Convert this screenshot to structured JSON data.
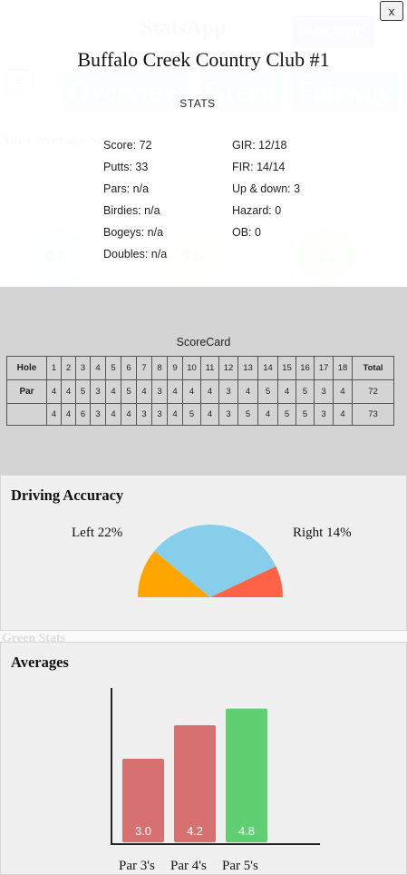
{
  "background": {
    "app_title": "StatsApp",
    "round_button_label": "ROUND",
    "menu_icon": "hamburger-icon",
    "tabs": [
      "Overview",
      "Green",
      "Fairway"
    ],
    "average_score_label": "Your Average Score",
    "circles": [
      {
        "value": "0.5",
        "color": "#9fb4e8"
      },
      {
        "value": "72",
        "color": "#e8e28a"
      },
      {
        "value": "1.2",
        "color": "#9fe0a8"
      }
    ],
    "green_stats_label": "Green Stats"
  },
  "modal": {
    "course_name": "Buffalo Creek Country Club #1",
    "close_label": "x",
    "stats_heading": "STATS",
    "stats_left": [
      "Score: 72",
      "Putts: 33",
      "Pars: n/a",
      "Birdies: n/a",
      "Bogeys: n/a",
      "Doubles: n/a"
    ],
    "stats_right": [
      "GIR: 12/18",
      "FIR: 14/14",
      "Up & down: 3",
      "Hazard: 0",
      "OB: 0"
    ]
  },
  "scorecard": {
    "title": "ScoreCard",
    "header_label": "Hole",
    "holes": [
      "1",
      "2",
      "3",
      "4",
      "5",
      "6",
      "7",
      "8",
      "9",
      "10",
      "11",
      "12",
      "13",
      "14",
      "15",
      "16",
      "17",
      "18"
    ],
    "total_label": "Total",
    "par_label": "Par",
    "par": [
      "4",
      "4",
      "5",
      "3",
      "4",
      "5",
      "4",
      "3",
      "4",
      "4",
      "4",
      "3",
      "4",
      "5",
      "4",
      "5",
      "3",
      "4"
    ],
    "par_total": "72",
    "score_label": "",
    "scores": [
      "4",
      "4",
      "6",
      "3",
      "4",
      "4",
      "3",
      "3",
      "4",
      "5",
      "4",
      "3",
      "5",
      "4",
      "5",
      "5",
      "3",
      "4"
    ],
    "score_total": "73"
  },
  "driving": {
    "title": "Driving Accuracy",
    "left_label": "Left 22%",
    "right_label": "Right 14%",
    "left_pct": 22,
    "right_pct": 14,
    "center_pct": 64,
    "colors": {
      "left": "#ffa500",
      "center": "#87ceeb",
      "right": "#ff6347"
    }
  },
  "averages": {
    "title": "Averages",
    "chart_data": {
      "type": "bar",
      "categories": [
        "Par 3's",
        "Par 4's",
        "Par 5's"
      ],
      "values": [
        3.0,
        4.2,
        4.8
      ],
      "value_labels": [
        "3.0",
        "4.2",
        "4.8"
      ],
      "colors": [
        "#d77070",
        "#d77070",
        "#5fcf72"
      ]
    }
  }
}
